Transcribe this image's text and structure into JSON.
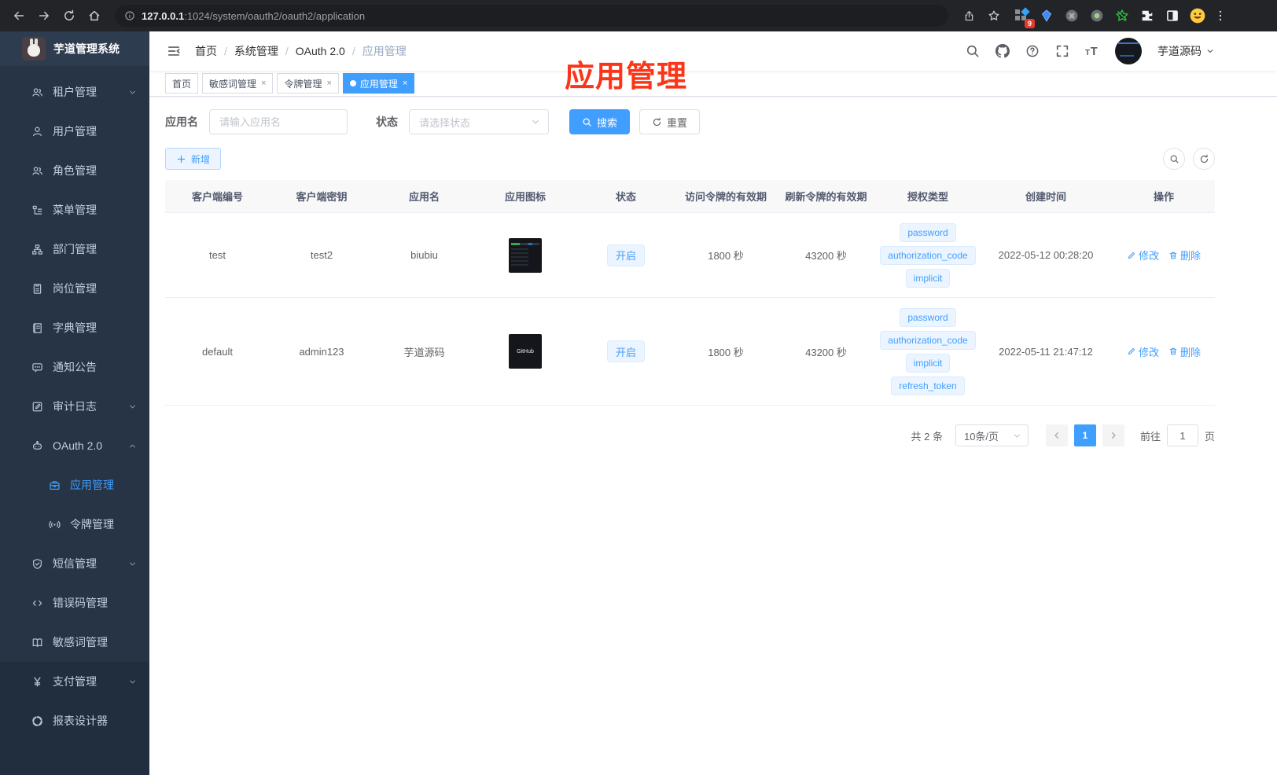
{
  "browser": {
    "url_host": "127.0.0.1",
    "url_path": ":1024/system/oauth2/oauth2/application",
    "extension_badge": "9"
  },
  "sidebar": {
    "title": "芋道管理系统",
    "items": [
      {
        "id": "tenant",
        "label": "租户管理",
        "icon": "users",
        "arrow": "down"
      },
      {
        "id": "user",
        "label": "用户管理",
        "icon": "user"
      },
      {
        "id": "role",
        "label": "角色管理",
        "icon": "users"
      },
      {
        "id": "menu",
        "label": "菜单管理",
        "icon": "menu-tree"
      },
      {
        "id": "dept",
        "label": "部门管理",
        "icon": "org"
      },
      {
        "id": "post",
        "label": "岗位管理",
        "icon": "badge"
      },
      {
        "id": "dict",
        "label": "字典管理",
        "icon": "dictionary"
      },
      {
        "id": "notice",
        "label": "通知公告",
        "icon": "message"
      },
      {
        "id": "audit-log",
        "label": "审计日志",
        "icon": "edit-log",
        "arrow": "down"
      },
      {
        "id": "oauth2",
        "label": "OAuth 2.0",
        "icon": "robot",
        "arrow": "up"
      },
      {
        "id": "oauth2-application",
        "label": "应用管理",
        "icon": "briefcase",
        "child": true,
        "active": true
      },
      {
        "id": "oauth2-token",
        "label": "令牌管理",
        "icon": "signal",
        "child": true
      },
      {
        "id": "sms",
        "label": "短信管理",
        "icon": "shield",
        "arrow": "down"
      },
      {
        "id": "error-code",
        "label": "错误码管理",
        "icon": "code"
      },
      {
        "id": "sensitive-word",
        "label": "敏感词管理",
        "icon": "open-book"
      },
      {
        "id": "payment",
        "label": "支付管理",
        "icon": "yen",
        "arrow": "down",
        "dark": true
      },
      {
        "id": "report-designer",
        "label": "报表设计器",
        "icon": "pie",
        "dark": true
      }
    ]
  },
  "navbar": {
    "breadcrumb": [
      "首页",
      "系统管理",
      "OAuth 2.0",
      "应用管理"
    ],
    "username": "芋道源码"
  },
  "tabs": [
    {
      "label": "首页",
      "closable": false,
      "active": false
    },
    {
      "label": "敏感词管理",
      "closable": true,
      "active": false
    },
    {
      "label": "令牌管理",
      "closable": true,
      "active": false
    },
    {
      "label": "应用管理",
      "closable": true,
      "active": true
    }
  ],
  "annotation": {
    "text": "应用管理",
    "color": "#fb3517"
  },
  "filters": {
    "name_label": "应用名",
    "name_placeholder": "请输入应用名",
    "status_label": "状态",
    "status_placeholder": "请选择状态",
    "search_label": "搜索",
    "reset_label": "重置",
    "add_label": "新增"
  },
  "table": {
    "headers": [
      "客户端编号",
      "客户端密钥",
      "应用名",
      "应用图标",
      "状态",
      "访问令牌的有效期",
      "刷新令牌的有效期",
      "授权类型",
      "创建时间",
      "操作"
    ],
    "actions": {
      "edit": "修改",
      "delete": "删除"
    },
    "rows": [
      {
        "client_id": "test",
        "secret": "test2",
        "name": "biubiu",
        "icon_text": "",
        "status": "开启",
        "access_ttl": "1800 秒",
        "refresh_ttl": "43200 秒",
        "grant_types": [
          "password",
          "authorization_code",
          "implicit"
        ],
        "created": "2022-05-12 00:28:20"
      },
      {
        "client_id": "default",
        "secret": "admin123",
        "name": "芋道源码",
        "icon_text": "GitHub",
        "status": "开启",
        "access_ttl": "1800 秒",
        "refresh_ttl": "43200 秒",
        "grant_types": [
          "password",
          "authorization_code",
          "implicit",
          "refresh_token"
        ],
        "created": "2022-05-11 21:47:12"
      }
    ]
  },
  "pagination": {
    "total": "共 2 条",
    "page_size": "10条/页",
    "current_page": "1",
    "goto_label": "前往",
    "goto_value": "1",
    "page_suffix": "页"
  }
}
